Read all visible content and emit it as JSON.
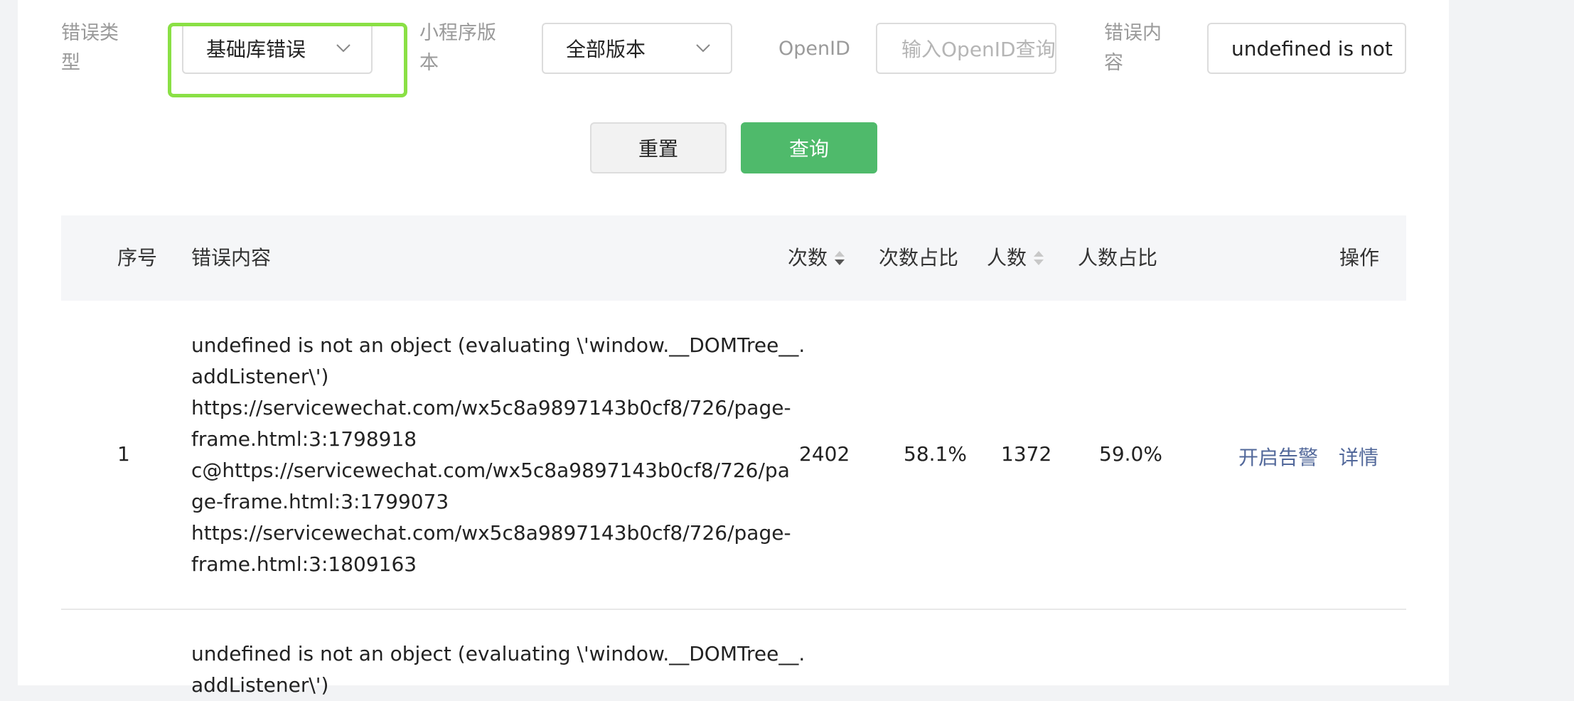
{
  "filters": {
    "error_type": {
      "label_line1": "错误类",
      "label_line2": "型",
      "value": "基础库错误"
    },
    "version": {
      "label_line1": "小程序版",
      "label_line2": "本",
      "value": "全部版本"
    },
    "openid": {
      "label": "OpenID",
      "placeholder": "输入OpenID查询"
    },
    "content": {
      "label_line1": "错误内",
      "label_line2": "容",
      "value": "undefined is not"
    }
  },
  "buttons": {
    "reset": "重置",
    "query": "查询"
  },
  "table": {
    "headers": {
      "index": "序号",
      "content": "错误内容",
      "count": "次数",
      "count_ratio": "次数占比",
      "users": "人数",
      "users_ratio": "人数占比",
      "actions": "操作"
    },
    "rows": [
      {
        "index": "1",
        "content_lines": [
          "undefined is not an object (evaluating \\'window.__DOMTree__.",
          "addListener\\')",
          "https://servicewechat.com/wx5c8a9897143b0cf8/726/page-",
          "frame.html:3:1798918",
          "c@https://servicewechat.com/wx5c8a9897143b0cf8/726/pa",
          "ge-frame.html:3:1799073",
          "https://servicewechat.com/wx5c8a9897143b0cf8/726/page-",
          "frame.html:3:1809163"
        ],
        "count": "2402",
        "count_ratio": "58.1%",
        "users": "1372",
        "users_ratio": "59.0%",
        "action_alert": "开启告警",
        "action_detail": "详情"
      },
      {
        "content_lines": [
          "undefined is not an object (evaluating \\'window.__DOMTree__.",
          "addListener\\')"
        ]
      }
    ]
  },
  "colors": {
    "accent_green": "#4fba6b",
    "highlight_green": "#8ae045",
    "link": "#52689a"
  },
  "icons": {
    "dropdown": "chevron-down-icon",
    "sort": "sort-icon"
  }
}
